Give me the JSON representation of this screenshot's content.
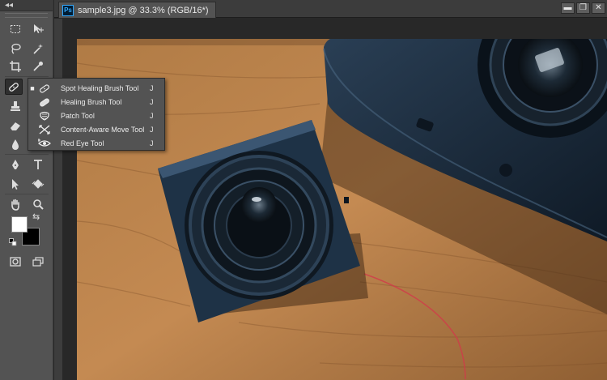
{
  "document": {
    "badge": "Ps",
    "title": "sample3.jpg @ 33.3% (RGB/16*)"
  },
  "window_controls": {
    "minimize": "▬",
    "restore": "❐",
    "close": "✕"
  },
  "toolbar": {
    "collapse_label": "◂◂",
    "swap_label": "⇆",
    "foreground_color": "#ffffff",
    "background_color": "#000000",
    "tools": [
      "rectangular-marquee-icon",
      "move-icon",
      "lasso-icon",
      "magic-wand-icon",
      "crop-icon",
      "eyedropper-icon",
      "spot-healing-brush-icon",
      "brush-icon",
      "clone-stamp-icon",
      "history-brush-icon",
      "eraser-icon",
      "gradient-icon",
      "blur-icon",
      "dodge-icon",
      "pen-icon",
      "type-icon",
      "path-selection-icon",
      "custom-shape-icon",
      "hand-icon",
      "zoom-icon",
      "quick-mask-icon",
      "screen-mode-icon"
    ]
  },
  "flyout": {
    "items": [
      {
        "label": "Spot Healing Brush Tool",
        "shortcut": "J",
        "selected": "■",
        "icon": "spot-healing-brush-icon"
      },
      {
        "label": "Healing Brush Tool",
        "shortcut": "J",
        "selected": "",
        "icon": "healing-brush-icon"
      },
      {
        "label": "Patch Tool",
        "shortcut": "J",
        "selected": "",
        "icon": "patch-icon"
      },
      {
        "label": "Content-Aware Move Tool",
        "shortcut": "J",
        "selected": "",
        "icon": "content-aware-move-icon"
      },
      {
        "label": "Red Eye Tool",
        "shortcut": "J",
        "selected": "",
        "icon": "red-eye-icon"
      }
    ]
  },
  "colors": {
    "panel": "#535353",
    "tabbar": "#3c3c3c",
    "canvas_bg": "#282828",
    "accent": "#31a8ff"
  }
}
